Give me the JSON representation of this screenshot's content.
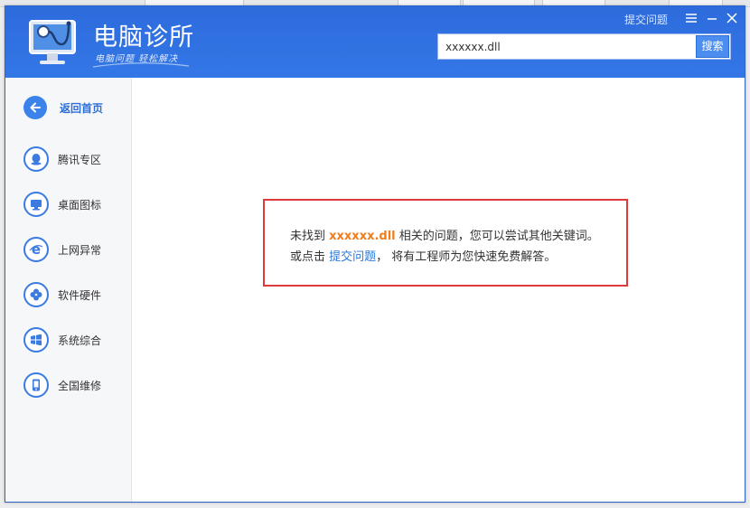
{
  "header": {
    "title": "电脑诊所",
    "subtitle": "电脑问题 轻松解决",
    "submit_link": "提交问题",
    "menu_icon": "menu-icon",
    "minimize_icon": "minimize-icon",
    "close_icon": "close-icon"
  },
  "search": {
    "value": "xxxxxx.dll",
    "button_label": "搜索"
  },
  "sidebar": {
    "back_label": "返回首页",
    "items": [
      {
        "label": "腾讯专区",
        "icon": "qq-penguin-icon"
      },
      {
        "label": "桌面图标",
        "icon": "monitor-icon"
      },
      {
        "label": "上网异常",
        "icon": "ie-browser-icon"
      },
      {
        "label": "软件硬件",
        "icon": "clover-icon"
      },
      {
        "label": "系统综合",
        "icon": "windows-logo-icon"
      },
      {
        "label": "全国维修",
        "icon": "phone-icon"
      }
    ]
  },
  "result": {
    "line1_prefix": "未找到",
    "keyword": "xxxxxx.dll",
    "line1_suffix": "相关的问题，您可以尝试其他关键词。",
    "line2_prefix": "或点击",
    "line2_link": "提交问题",
    "line2_suffix": "， 将有工程师为您快速免费解答。"
  },
  "colors": {
    "header_blue": "#2f6fe0",
    "accent_orange": "#f07c1a",
    "link_blue": "#2d78d8",
    "notice_border": "#e0393b"
  }
}
